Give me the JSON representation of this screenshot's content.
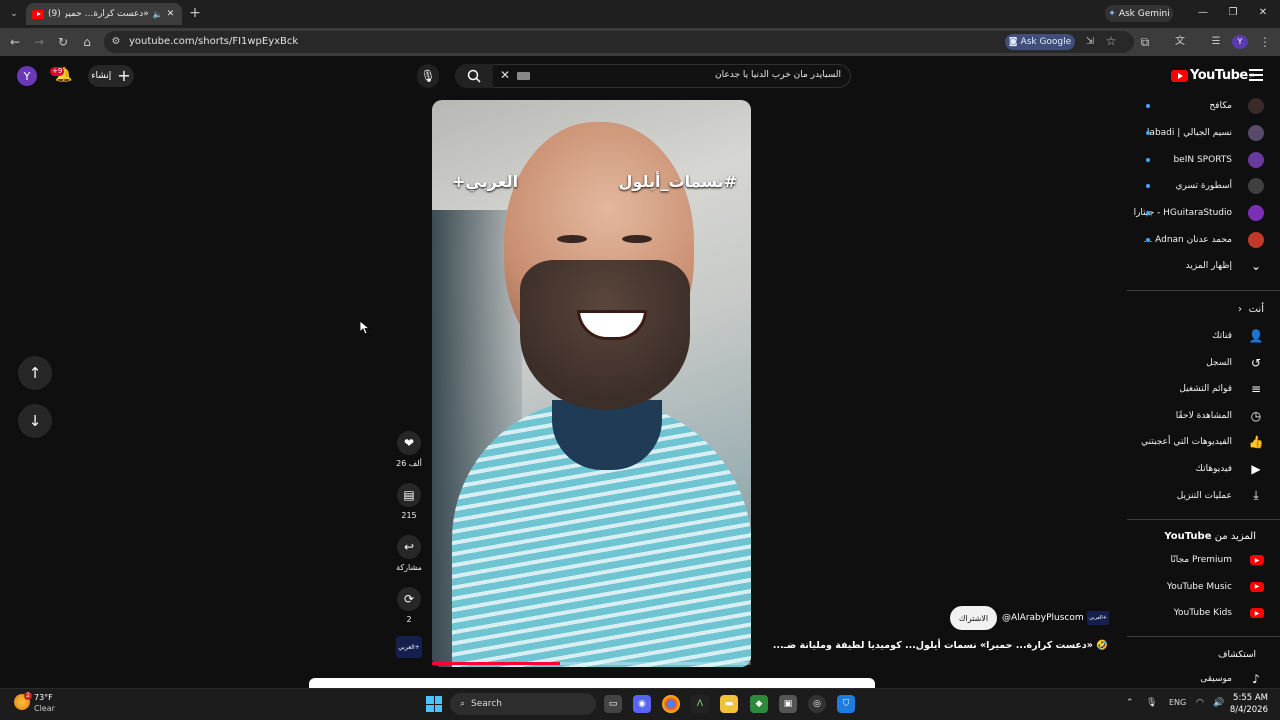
{
  "browser": {
    "tab_title": "«دعست كرارة... حميرا",
    "tab_badge": "(9)",
    "url": "youtube.com/shorts/FI1wpEyxBck",
    "ask_gemini": "Ask Gemini",
    "ask_google": "Ask Google"
  },
  "header": {
    "avatar_letter": "Y",
    "notif_count": "+9",
    "create_label": "إنشاء",
    "search_value": "السبايدر مان خرب الدنيا يا جدعان",
    "logo_text": "YouTube",
    "logo_sup": "JO"
  },
  "short": {
    "overlay_left": "العربي+",
    "overlay_right": "#نسمات_أيلول",
    "progress_percent": 40,
    "likes": "26 ألف",
    "comments": "215",
    "share": "مشاركة",
    "remix": "2",
    "channel_thumb": "العربي+",
    "subscribe": "الاشتراك",
    "channel": "@AlArabyPluscom",
    "title": "🤣 «دعست كرارة... حميرا» نسمات أيلول... كوميديا لطيفة ومليانة ضـ..."
  },
  "sidebar": {
    "subscriptions": [
      {
        "label": "مكافح",
        "color": "#3a2a2a"
      },
      {
        "label": "نسيم الجبالي | labadi",
        "color": "#5a4a6a"
      },
      {
        "label": "beIN SPORTS",
        "color": "#6b3aa0"
      },
      {
        "label": "أسطورة تسري",
        "color": "#404040"
      },
      {
        "label": "HGuitaraStudio - جيتارا",
        "color": "#7a2fb5"
      },
      {
        "label": "محمد عدنان Adnan ...",
        "color": "#c0392b"
      }
    ],
    "show_more": "إظهار المزيد",
    "you_section": "أنت",
    "you_items": [
      {
        "label": "قناتك",
        "icon": "user-icon"
      },
      {
        "label": "السجل",
        "icon": "history-icon"
      },
      {
        "label": "قوائم التشغيل",
        "icon": "playlist-icon"
      },
      {
        "label": "المشاهدة لاحقًا",
        "icon": "clock-icon"
      },
      {
        "label": "الفيديوهات التي أعجبتني",
        "icon": "thumb-up-icon"
      },
      {
        "label": "فيديوهاتك",
        "icon": "video-icon"
      },
      {
        "label": "عمليات التنزيل",
        "icon": "download-icon"
      }
    ],
    "more_from": "المزيد من",
    "more_from_brand": "YouTube",
    "more_items": [
      {
        "label": "Premium مجانًا",
        "color": "#ff0000"
      },
      {
        "label": "YouTube Music",
        "color": "#ff0000"
      },
      {
        "label": "YouTube Kids",
        "color": "#ff0000"
      }
    ],
    "explore": "استكشاف",
    "music": "موسيقى"
  },
  "taskbar": {
    "weather_temp": "73°F",
    "weather_cond": "Clear",
    "weather_badge": "2",
    "search": "Search",
    "lang": "ENG",
    "time": "5:55 AM",
    "date": "8/4/2026"
  }
}
